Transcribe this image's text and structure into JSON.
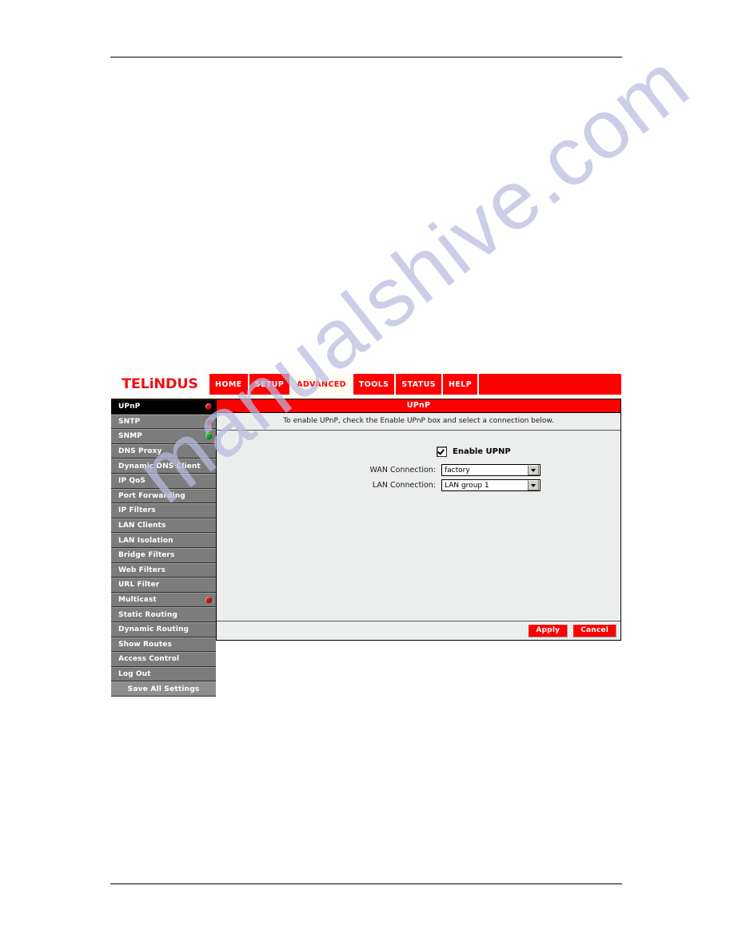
{
  "watermark": {
    "text": "manualshive.com"
  },
  "router_ui": {
    "brand": "TELiNDUS",
    "nav_tabs": [
      {
        "label": "HOME",
        "active": false
      },
      {
        "label": "SETUP",
        "active": false
      },
      {
        "label": "ADVANCED",
        "active": true
      },
      {
        "label": "TOOLS",
        "active": false
      },
      {
        "label": "STATUS",
        "active": false
      },
      {
        "label": "HELP",
        "active": false
      }
    ],
    "sidebar": [
      {
        "label": "UPnP",
        "selected": true,
        "status": "red"
      },
      {
        "label": "SNTP",
        "selected": false,
        "status": "red"
      },
      {
        "label": "SNMP",
        "selected": false,
        "status": "green"
      },
      {
        "label": "DNS Proxy",
        "selected": false,
        "status": "none"
      },
      {
        "label": "Dynamic DNS Client",
        "selected": false,
        "status": "none"
      },
      {
        "label": "IP QoS",
        "selected": false,
        "status": "none"
      },
      {
        "label": "Port Forwarding",
        "selected": false,
        "status": "none"
      },
      {
        "label": "IP Filters",
        "selected": false,
        "status": "none"
      },
      {
        "label": "LAN Clients",
        "selected": false,
        "status": "none"
      },
      {
        "label": "LAN Isolation",
        "selected": false,
        "status": "none"
      },
      {
        "label": "Bridge Filters",
        "selected": false,
        "status": "none"
      },
      {
        "label": "Web Filters",
        "selected": false,
        "status": "none"
      },
      {
        "label": "URL Filter",
        "selected": false,
        "status": "none"
      },
      {
        "label": "Multicast",
        "selected": false,
        "status": "red"
      },
      {
        "label": "Static Routing",
        "selected": false,
        "status": "none"
      },
      {
        "label": "Dynamic Routing",
        "selected": false,
        "status": "none"
      },
      {
        "label": "Show Routes",
        "selected": false,
        "status": "none"
      },
      {
        "label": "Access Control",
        "selected": false,
        "status": "none"
      },
      {
        "label": "Log Out",
        "selected": false,
        "status": "none"
      },
      {
        "label": "Save All Settings",
        "selected": false,
        "status": "none"
      }
    ],
    "panel": {
      "title": "UPnP",
      "description": "To enable UPnP, check the Enable UPnP box and select a connection below.",
      "enable_checkbox_label": "Enable UPNP",
      "enable_checkbox_checked": true,
      "fields": [
        {
          "label": "WAN Connection:",
          "value": "factory"
        },
        {
          "label": "LAN Connection:",
          "value": "LAN group 1"
        }
      ],
      "apply_label": "Apply",
      "cancel_label": "Cancel"
    },
    "colors": {
      "brand_red": "#fe0000",
      "status_red": "#d81010",
      "status_green": "#12b012",
      "panel_bg": "#eceded",
      "sidebar_bg": "#7c7c7c",
      "sidebar_selected": "#000000"
    }
  }
}
